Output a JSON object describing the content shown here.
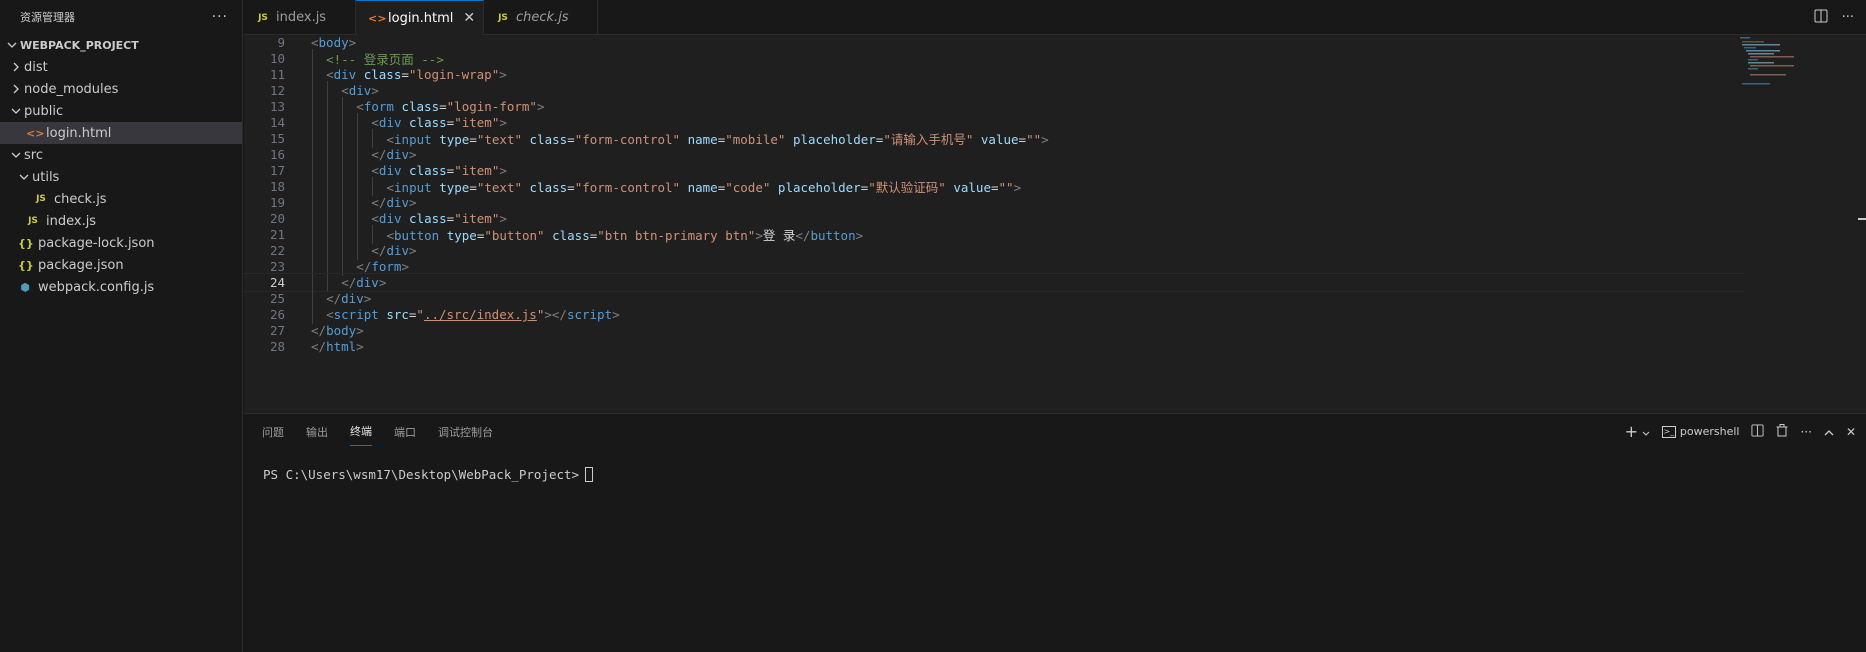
{
  "sidebar": {
    "title": "资源管理器",
    "more": "···",
    "project": "WEBPACK_PROJECT",
    "items": [
      {
        "label": "dist",
        "type": "folder",
        "expanded": false,
        "depth": 0
      },
      {
        "label": "node_modules",
        "type": "folder",
        "expanded": false,
        "depth": 0
      },
      {
        "label": "public",
        "type": "folder",
        "expanded": true,
        "depth": 0
      },
      {
        "label": "login.html",
        "type": "html",
        "depth": 1,
        "selected": true
      },
      {
        "label": "src",
        "type": "folder",
        "expanded": true,
        "depth": 0
      },
      {
        "label": "utils",
        "type": "folder",
        "expanded": true,
        "depth": 1
      },
      {
        "label": "check.js",
        "type": "js",
        "depth": 2
      },
      {
        "label": "index.js",
        "type": "js",
        "depth": 1
      },
      {
        "label": "package-lock.json",
        "type": "json",
        "depth": 0
      },
      {
        "label": "package.json",
        "type": "json",
        "depth": 0
      },
      {
        "label": "webpack.config.js",
        "type": "webpack",
        "depth": 0
      }
    ]
  },
  "tabs": [
    {
      "label": "index.js",
      "icon": "JS",
      "active": false,
      "italic": false
    },
    {
      "label": "login.html",
      "icon": "<>",
      "active": true,
      "italic": false
    },
    {
      "label": "check.js",
      "icon": "JS",
      "active": false,
      "italic": true
    }
  ],
  "icons": {
    "js": "JS",
    "html": "<>",
    "json": "{}",
    "webpack": "⬢",
    "close": "✕"
  },
  "editor": {
    "current_line": 24,
    "lines": [
      {
        "n": 9,
        "indent": 0,
        "tokens": [
          [
            "t-br",
            "<"
          ],
          [
            "t-tag",
            "body"
          ],
          [
            "t-br",
            ">"
          ]
        ]
      },
      {
        "n": 10,
        "indent": 1,
        "tokens": [
          [
            "t-com",
            "<!-- 登录页面 -->"
          ]
        ]
      },
      {
        "n": 11,
        "indent": 1,
        "tokens": [
          [
            "t-br",
            "<"
          ],
          [
            "t-tag",
            "div"
          ],
          [
            "t-txt",
            " "
          ],
          [
            "t-attr",
            "class"
          ],
          [
            "t-txt",
            "="
          ],
          [
            "t-str",
            "\"login-wrap\""
          ],
          [
            "t-br",
            ">"
          ]
        ]
      },
      {
        "n": 12,
        "indent": 2,
        "tokens": [
          [
            "t-br",
            "<"
          ],
          [
            "t-tag",
            "div"
          ],
          [
            "t-br",
            ">"
          ]
        ]
      },
      {
        "n": 13,
        "indent": 3,
        "tokens": [
          [
            "t-br",
            "<"
          ],
          [
            "t-tag",
            "form"
          ],
          [
            "t-txt",
            " "
          ],
          [
            "t-attr",
            "class"
          ],
          [
            "t-txt",
            "="
          ],
          [
            "t-str",
            "\"login-form\""
          ],
          [
            "t-br",
            ">"
          ]
        ]
      },
      {
        "n": 14,
        "indent": 4,
        "tokens": [
          [
            "t-br",
            "<"
          ],
          [
            "t-tag",
            "div"
          ],
          [
            "t-txt",
            " "
          ],
          [
            "t-attr",
            "class"
          ],
          [
            "t-txt",
            "="
          ],
          [
            "t-str",
            "\"item\""
          ],
          [
            "t-br",
            ">"
          ]
        ]
      },
      {
        "n": 15,
        "indent": 5,
        "tokens": [
          [
            "t-br",
            "<"
          ],
          [
            "t-tag",
            "input"
          ],
          [
            "t-txt",
            " "
          ],
          [
            "t-attr",
            "type"
          ],
          [
            "t-txt",
            "="
          ],
          [
            "t-str",
            "\"text\""
          ],
          [
            "t-txt",
            " "
          ],
          [
            "t-attr",
            "class"
          ],
          [
            "t-txt",
            "="
          ],
          [
            "t-str",
            "\"form-control\""
          ],
          [
            "t-txt",
            " "
          ],
          [
            "t-attr",
            "name"
          ],
          [
            "t-txt",
            "="
          ],
          [
            "t-str",
            "\"mobile\""
          ],
          [
            "t-txt",
            " "
          ],
          [
            "t-attr",
            "placeholder"
          ],
          [
            "t-txt",
            "="
          ],
          [
            "t-str",
            "\"请输入手机号\""
          ],
          [
            "t-txt",
            " "
          ],
          [
            "t-attr",
            "value"
          ],
          [
            "t-txt",
            "="
          ],
          [
            "t-str",
            "\"\""
          ],
          [
            "t-br",
            ">"
          ]
        ]
      },
      {
        "n": 16,
        "indent": 4,
        "tokens": [
          [
            "t-br",
            "</"
          ],
          [
            "t-tag",
            "div"
          ],
          [
            "t-br",
            ">"
          ]
        ]
      },
      {
        "n": 17,
        "indent": 4,
        "tokens": [
          [
            "t-br",
            "<"
          ],
          [
            "t-tag",
            "div"
          ],
          [
            "t-txt",
            " "
          ],
          [
            "t-attr",
            "class"
          ],
          [
            "t-txt",
            "="
          ],
          [
            "t-str",
            "\"item\""
          ],
          [
            "t-br",
            ">"
          ]
        ]
      },
      {
        "n": 18,
        "indent": 5,
        "tokens": [
          [
            "t-br",
            "<"
          ],
          [
            "t-tag",
            "input"
          ],
          [
            "t-txt",
            " "
          ],
          [
            "t-attr",
            "type"
          ],
          [
            "t-txt",
            "="
          ],
          [
            "t-str",
            "\"text\""
          ],
          [
            "t-txt",
            " "
          ],
          [
            "t-attr",
            "class"
          ],
          [
            "t-txt",
            "="
          ],
          [
            "t-str",
            "\"form-control\""
          ],
          [
            "t-txt",
            " "
          ],
          [
            "t-attr",
            "name"
          ],
          [
            "t-txt",
            "="
          ],
          [
            "t-str",
            "\"code\""
          ],
          [
            "t-txt",
            " "
          ],
          [
            "t-attr",
            "placeholder"
          ],
          [
            "t-txt",
            "="
          ],
          [
            "t-str",
            "\"默认验证码\""
          ],
          [
            "t-txt",
            " "
          ],
          [
            "t-attr",
            "value"
          ],
          [
            "t-txt",
            "="
          ],
          [
            "t-str",
            "\"\""
          ],
          [
            "t-br",
            ">"
          ]
        ]
      },
      {
        "n": 19,
        "indent": 4,
        "tokens": [
          [
            "t-br",
            "</"
          ],
          [
            "t-tag",
            "div"
          ],
          [
            "t-br",
            ">"
          ]
        ]
      },
      {
        "n": 20,
        "indent": 4,
        "tokens": [
          [
            "t-br",
            "<"
          ],
          [
            "t-tag",
            "div"
          ],
          [
            "t-txt",
            " "
          ],
          [
            "t-attr",
            "class"
          ],
          [
            "t-txt",
            "="
          ],
          [
            "t-str",
            "\"item\""
          ],
          [
            "t-br",
            ">"
          ]
        ]
      },
      {
        "n": 21,
        "indent": 5,
        "tokens": [
          [
            "t-br",
            "<"
          ],
          [
            "t-tag",
            "button"
          ],
          [
            "t-txt",
            " "
          ],
          [
            "t-attr",
            "type"
          ],
          [
            "t-txt",
            "="
          ],
          [
            "t-str",
            "\"button\""
          ],
          [
            "t-txt",
            " "
          ],
          [
            "t-attr",
            "class"
          ],
          [
            "t-txt",
            "="
          ],
          [
            "t-str",
            "\"btn btn-primary btn\""
          ],
          [
            "t-br",
            ">"
          ],
          [
            "t-txt",
            "登 录"
          ],
          [
            "t-br",
            "</"
          ],
          [
            "t-tag",
            "button"
          ],
          [
            "t-br",
            ">"
          ]
        ]
      },
      {
        "n": 22,
        "indent": 4,
        "tokens": [
          [
            "t-br",
            "</"
          ],
          [
            "t-tag",
            "div"
          ],
          [
            "t-br",
            ">"
          ]
        ]
      },
      {
        "n": 23,
        "indent": 3,
        "tokens": [
          [
            "t-br",
            "</"
          ],
          [
            "t-tag",
            "form"
          ],
          [
            "t-br",
            ">"
          ]
        ]
      },
      {
        "n": 24,
        "indent": 2,
        "tokens": [
          [
            "t-br",
            "</"
          ],
          [
            "t-tag",
            "div"
          ],
          [
            "t-br",
            ">"
          ]
        ]
      },
      {
        "n": 25,
        "indent": 1,
        "tokens": [
          [
            "t-br",
            "</"
          ],
          [
            "t-tag",
            "div"
          ],
          [
            "t-br",
            ">"
          ]
        ]
      },
      {
        "n": 26,
        "indent": 1,
        "tokens": [
          [
            "t-br",
            "<"
          ],
          [
            "t-tag",
            "script"
          ],
          [
            "t-txt",
            " "
          ],
          [
            "t-attr",
            "src"
          ],
          [
            "t-txt",
            "="
          ],
          [
            "t-str",
            "\""
          ],
          [
            "t-link",
            "../src/index.js"
          ],
          [
            "t-str",
            "\""
          ],
          [
            "t-br",
            "></"
          ],
          [
            "t-tag",
            "script"
          ],
          [
            "t-br",
            ">"
          ]
        ]
      },
      {
        "n": 27,
        "indent": 0,
        "tokens": [
          [
            "t-br",
            "</"
          ],
          [
            "t-tag",
            "body"
          ],
          [
            "t-br",
            ">"
          ]
        ]
      },
      {
        "n": 28,
        "indent": 0,
        "tokens": [
          [
            "t-br",
            "</"
          ],
          [
            "t-tag",
            "html"
          ],
          [
            "t-br",
            ">"
          ]
        ]
      }
    ]
  },
  "panel": {
    "tabs": [
      "问题",
      "输出",
      "终端",
      "端口",
      "调试控制台"
    ],
    "active_tab": "终端",
    "shell": "powershell",
    "add": "+",
    "prompt": "PS C:\\Users\\wsm17\\Desktop\\WebPack_Project>"
  },
  "colors": {
    "accent": "#0078d4",
    "tag": "#569cd6",
    "attr": "#9cdcfe",
    "string": "#ce9178",
    "comment": "#6a9955"
  }
}
